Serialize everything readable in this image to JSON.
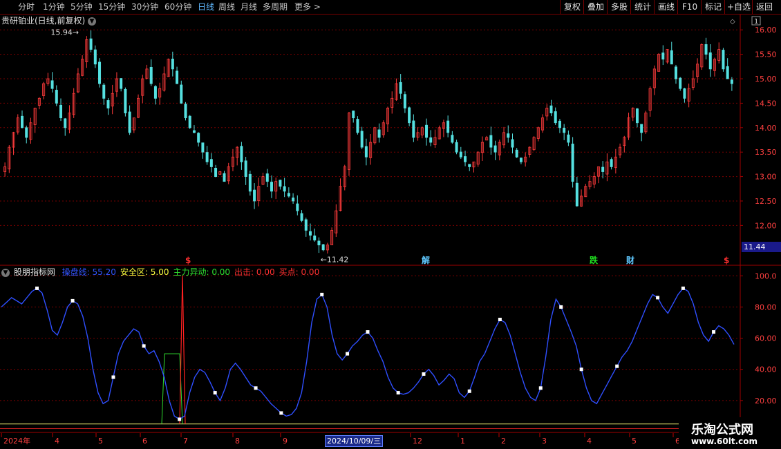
{
  "toolbar": {
    "periods": [
      {
        "label": "分时",
        "active": false
      },
      {
        "label": "1分钟",
        "active": false
      },
      {
        "label": "5分钟",
        "active": false
      },
      {
        "label": "15分钟",
        "active": false
      },
      {
        "label": "30分钟",
        "active": false
      },
      {
        "label": "60分钟",
        "active": false
      },
      {
        "label": "日线",
        "active": true
      },
      {
        "label": "周线",
        "active": false
      },
      {
        "label": "月线",
        "active": false
      },
      {
        "label": "多周期",
        "active": false
      },
      {
        "label": "更多",
        "active": false
      }
    ],
    "more_arrow": ">",
    "buttons": [
      "复权",
      "叠加",
      "多股",
      "统计",
      "画线",
      "F10",
      "标记",
      "+自选",
      "返回"
    ]
  },
  "main_chart": {
    "title": "贵研铂业(日线,前复权)",
    "number_badge": "1",
    "price_ticks": [
      "16.00",
      "15.50",
      "15.00",
      "14.50",
      "14.00",
      "13.50",
      "13.00",
      "12.50",
      "12.00"
    ],
    "current_price": "11.44",
    "high_label": "15.94",
    "low_label": "11.42",
    "markers": [
      {
        "text": "$",
        "color": "#ff3030"
      },
      {
        "text": "解",
        "color": "#5fc8ff"
      },
      {
        "text": "跌",
        "color": "#20e020"
      },
      {
        "text": "财",
        "color": "#5fc8ff"
      },
      {
        "text": "$",
        "color": "#ff3030"
      }
    ]
  },
  "indicator": {
    "name": "股朋指标网",
    "values": [
      {
        "label": "操盘线:",
        "value": "55.20",
        "color": "#3355ff"
      },
      {
        "label": "安全区:",
        "value": "5.00",
        "color": "#ffff40"
      },
      {
        "label": "主力异动:",
        "value": "0.00",
        "color": "#30e030"
      },
      {
        "label": "出击:",
        "value": "0.00",
        "color": "#ff3030"
      },
      {
        "label": "买点:",
        "value": "0.00",
        "color": "#ff3030"
      }
    ],
    "ticks": [
      "100.0",
      "80.00",
      "60.00",
      "40.00",
      "20.00"
    ]
  },
  "date_axis": {
    "labels": [
      "2024年",
      "4",
      "5",
      "6",
      "7",
      "8",
      "9",
      "12",
      "1",
      "2",
      "3",
      "4",
      "5",
      "6"
    ],
    "highlight": "2024/10/09/三"
  },
  "watermark": {
    "line1": "乐淘公式网",
    "line2": "www.60lt.com"
  },
  "chart_data": {
    "type": "candlestick",
    "title": "贵研铂业(日线,前复权)",
    "ylim": [
      11.2,
      16.3
    ],
    "price_axis": [
      16.0,
      15.5,
      15.0,
      14.5,
      14.0,
      13.5,
      13.0,
      12.5,
      12.0
    ],
    "annotations": {
      "high": 15.94,
      "low": 11.42,
      "last": 11.44
    },
    "closes": [
      13.2,
      13.6,
      13.9,
      14.2,
      14.0,
      13.8,
      14.1,
      14.4,
      14.6,
      14.9,
      15.0,
      14.8,
      14.5,
      14.2,
      14.0,
      14.3,
      14.7,
      15.1,
      15.4,
      15.8,
      15.6,
      15.3,
      14.9,
      14.6,
      14.4,
      14.7,
      15.0,
      14.8,
      14.3,
      13.9,
      14.2,
      14.6,
      15.0,
      15.2,
      14.9,
      14.6,
      14.8,
      15.1,
      15.4,
      15.2,
      14.9,
      14.5,
      14.2,
      14.0,
      13.9,
      13.7,
      13.5,
      13.3,
      13.2,
      13.0,
      13.1,
      12.9,
      13.2,
      13.4,
      13.6,
      13.3,
      13.0,
      12.7,
      12.5,
      12.8,
      13.0,
      12.9,
      12.7,
      12.9,
      12.8,
      12.7,
      12.6,
      12.5,
      12.3,
      12.1,
      11.9,
      11.8,
      11.7,
      11.6,
      11.5,
      11.6,
      11.9,
      12.3,
      12.8,
      13.2,
      14.3,
      14.2,
      13.9,
      13.6,
      13.4,
      13.7,
      14.0,
      13.8,
      14.1,
      14.4,
      14.6,
      14.9,
      14.7,
      14.4,
      14.1,
      13.8,
      13.9,
      14.0,
      13.8,
      13.7,
      13.8,
      14.0,
      14.1,
      13.9,
      13.7,
      13.5,
      13.4,
      13.3,
      13.2,
      13.3,
      13.5,
      13.7,
      13.8,
      13.6,
      13.5,
      13.7,
      13.9,
      13.8,
      13.6,
      13.4,
      13.3,
      13.4,
      13.6,
      13.8,
      14.0,
      14.2,
      14.4,
      14.3,
      14.1,
      14.0,
      13.9,
      13.7,
      12.9,
      12.4,
      12.6,
      12.8,
      12.9,
      13.0,
      13.2,
      13.1,
      13.3,
      13.2,
      13.4,
      13.6,
      13.8,
      14.2,
      14.4,
      14.1,
      13.9,
      14.3,
      14.8,
      15.2,
      15.5,
      15.4,
      15.6,
      15.3,
      15.0,
      14.8,
      14.6,
      14.8,
      15.0,
      15.3,
      15.7,
      15.5,
      15.2,
      15.4,
      15.6,
      15.2,
      15.0,
      14.9
    ],
    "indicator": {
      "name": "股朋指标网",
      "ylim": [
        0,
        105
      ],
      "ticks": [
        100,
        80,
        60,
        40,
        20
      ],
      "series": [
        {
          "name": "操盘线",
          "color": "#3355ff",
          "values": [
            80,
            83,
            86,
            84,
            82,
            86,
            90,
            92,
            89,
            78,
            65,
            62,
            70,
            80,
            84,
            82,
            74,
            60,
            40,
            25,
            18,
            20,
            35,
            50,
            58,
            62,
            66,
            64,
            55,
            50,
            52,
            45,
            35,
            20,
            10,
            8,
            10,
            25,
            35,
            40,
            38,
            32,
            25,
            20,
            28,
            40,
            44,
            40,
            35,
            30,
            28,
            26,
            22,
            18,
            15,
            12,
            10,
            11,
            15,
            25,
            45,
            70,
            85,
            88,
            80,
            62,
            50,
            46,
            50,
            55,
            58,
            62,
            64,
            60,
            52,
            45,
            35,
            28,
            25,
            24,
            25,
            28,
            32,
            37,
            40,
            36,
            30,
            33,
            37,
            34,
            25,
            22,
            26,
            35,
            45,
            50,
            58,
            66,
            72,
            70,
            62,
            50,
            38,
            28,
            22,
            20,
            28,
            48,
            72,
            85,
            80,
            72,
            64,
            55,
            40,
            28,
            20,
            18,
            24,
            30,
            36,
            42,
            48,
            52,
            58,
            66,
            74,
            82,
            88,
            86,
            80,
            76,
            82,
            88,
            92,
            90,
            82,
            70,
            62,
            58,
            64,
            68,
            66,
            62,
            56
          ]
        },
        {
          "name": "安全区",
          "color": "#ffff40",
          "values": [
            5
          ]
        }
      ]
    },
    "x_labels": [
      "2024年",
      "4",
      "5",
      "6",
      "7",
      "8",
      "9",
      "12",
      "1",
      "2",
      "3",
      "4",
      "5",
      "6"
    ]
  }
}
